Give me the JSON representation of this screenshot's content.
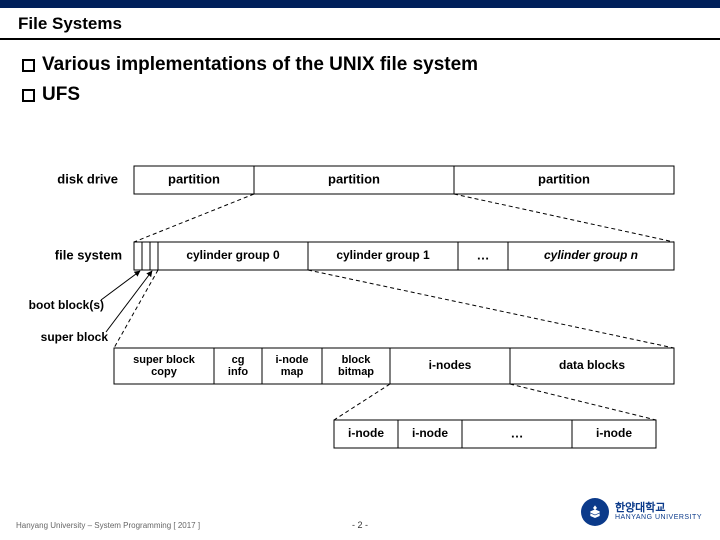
{
  "page": {
    "title": "File Systems",
    "bullets": [
      "Various implementations of the UNIX file system",
      "UFS"
    ]
  },
  "diagram": {
    "labels": {
      "disk_drive": "disk drive",
      "file_system": "file system",
      "boot_blocks": "boot block(s)",
      "super_block": "super block"
    },
    "partitions": [
      "partition",
      "partition",
      "partition"
    ],
    "cylinder_groups": [
      "cylinder group 0",
      "cylinder group 1",
      "…",
      "cylinder group n"
    ],
    "cg_detail": [
      "super block copy",
      "cg info",
      "i-node map",
      "block bitmap",
      "i-nodes",
      "data blocks"
    ],
    "inode_row": [
      "i-node",
      "i-node",
      "…",
      "i-node"
    ]
  },
  "footer": {
    "left": "Hanyang University – System Programming [ 2017 ]",
    "page_num": "- 2 -",
    "uni_ko": "한양대학교",
    "uni_en": "HANYANG UNIVERSITY"
  }
}
